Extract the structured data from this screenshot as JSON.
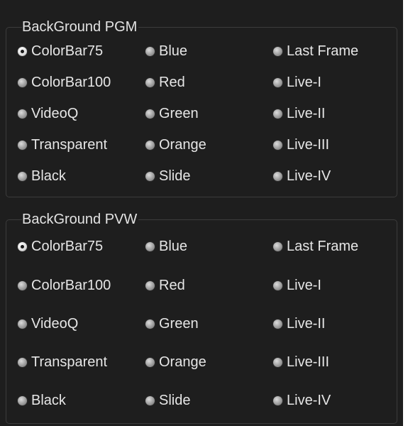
{
  "groups": [
    {
      "title": "BackGround PGM",
      "selected": "ColorBar75",
      "columns": [
        [
          "ColorBar75",
          "ColorBar100",
          "VideoQ",
          "Transparent",
          "Black"
        ],
        [
          "Blue",
          "Red",
          "Green",
          "Orange",
          "Slide"
        ],
        [
          "Last Frame",
          "Live-I",
          "Live-II",
          "Live-III",
          "Live-IV"
        ]
      ]
    },
    {
      "title": "BackGround PVW",
      "selected": "ColorBar75",
      "columns": [
        [
          "ColorBar75",
          "ColorBar100",
          "VideoQ",
          "Transparent",
          "Black"
        ],
        [
          "Blue",
          "Red",
          "Green",
          "Orange",
          "Slide"
        ],
        [
          "Last Frame",
          "Live-I",
          "Live-II",
          "Live-III",
          "Live-IV"
        ]
      ]
    }
  ]
}
